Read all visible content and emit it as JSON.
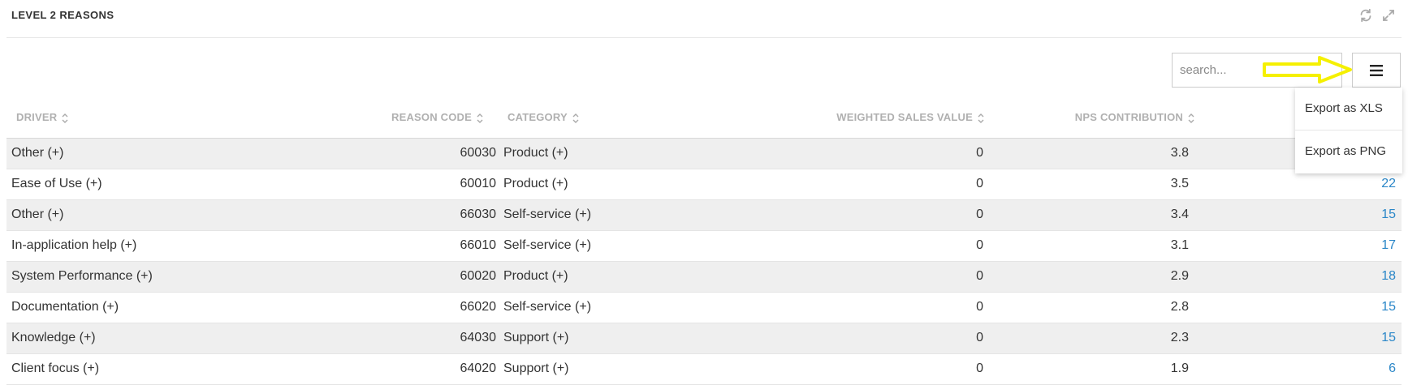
{
  "panel": {
    "title": "LEVEL 2 REASONS",
    "header_icons": [
      "refresh-icon",
      "expand-icon"
    ]
  },
  "toolbar": {
    "search_placeholder": "search...",
    "menu_icon": "hamburger-menu-icon",
    "annotation": "yellow-arrow-pointing-right",
    "annotation_color": "#f5f000"
  },
  "menu": {
    "items": [
      {
        "label": "Export as XLS"
      },
      {
        "label": "Export as PNG"
      }
    ]
  },
  "table": {
    "columns": [
      {
        "label": "DRIVER"
      },
      {
        "label": "REASON CODE"
      },
      {
        "label": "CATEGORY"
      },
      {
        "label": "WEIGHTED SALES VALUE"
      },
      {
        "label": "NPS CONTRIBUTION"
      }
    ],
    "rows": [
      {
        "driver": "Other (+)",
        "code": "60030",
        "category": "Product (+)",
        "wsv": "0",
        "nps": "3.8",
        "count": ""
      },
      {
        "driver": "Ease of Use (+)",
        "code": "60010",
        "category": "Product (+)",
        "wsv": "0",
        "nps": "3.5",
        "count": "22"
      },
      {
        "driver": "Other (+)",
        "code": "66030",
        "category": "Self-service (+)",
        "wsv": "0",
        "nps": "3.4",
        "count": "15"
      },
      {
        "driver": "In-application help (+)",
        "code": "66010",
        "category": "Self-service (+)",
        "wsv": "0",
        "nps": "3.1",
        "count": "17"
      },
      {
        "driver": "System Performance (+)",
        "code": "60020",
        "category": "Product (+)",
        "wsv": "0",
        "nps": "2.9",
        "count": "18"
      },
      {
        "driver": "Documentation (+)",
        "code": "66020",
        "category": "Self-service (+)",
        "wsv": "0",
        "nps": "2.8",
        "count": "15"
      },
      {
        "driver": "Knowledge (+)",
        "code": "64030",
        "category": "Support (+)",
        "wsv": "0",
        "nps": "2.3",
        "count": "15"
      },
      {
        "driver": "Client focus (+)",
        "code": "64020",
        "category": "Support (+)",
        "wsv": "0",
        "nps": "1.9",
        "count": "6"
      }
    ]
  },
  "colors": {
    "link": "#2b87c8",
    "header_text": "#b0b0b0",
    "row_stripe": "#efefef"
  }
}
